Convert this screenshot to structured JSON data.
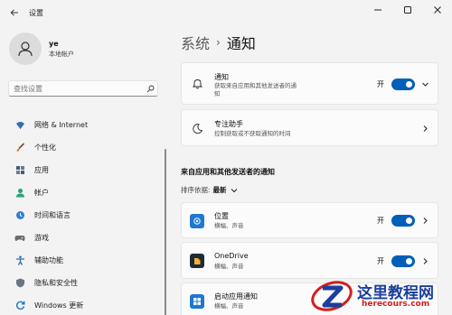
{
  "window": {
    "title": "设置"
  },
  "profile": {
    "name": "ye",
    "account_type": "本地帐户"
  },
  "search": {
    "placeholder": "查找设置"
  },
  "sidebar": {
    "items": [
      {
        "label": "网络 & Internet",
        "icon": "network-icon",
        "color": "#2f6cb8"
      },
      {
        "label": "个性化",
        "icon": "brush-icon",
        "color": "#d07a2c"
      },
      {
        "label": "应用",
        "icon": "apps-icon",
        "color": "#4a5a78"
      },
      {
        "label": "帐户",
        "icon": "person-icon",
        "color": "#2aa17a"
      },
      {
        "label": "时间和语言",
        "icon": "globe-clock-icon",
        "color": "#2f7fd0"
      },
      {
        "label": "游戏",
        "icon": "gamepad-icon",
        "color": "#6b6b6b"
      },
      {
        "label": "辅助功能",
        "icon": "accessibility-icon",
        "color": "#2f6cb8"
      },
      {
        "label": "隐私和安全性",
        "icon": "shield-icon",
        "color": "#6b7384"
      },
      {
        "label": "Windows 更新",
        "icon": "update-icon",
        "color": "#1e78d2"
      }
    ]
  },
  "breadcrumb": {
    "parent": "系统",
    "separator": "›",
    "current": "通知"
  },
  "notifications_card": {
    "title": "通知",
    "subtitle": "获取来自应用和其他发送者的通",
    "subtitle2": "知",
    "toggle_label": "开",
    "toggle_on": true
  },
  "focus_card": {
    "title": "专注助手",
    "subtitle": "控制获取或不获取通知的时间"
  },
  "senders_section": {
    "title": "来自应用和其他发送者的通知"
  },
  "sort": {
    "label": "排序依据:",
    "value": "最新"
  },
  "apps": [
    {
      "name": "位置",
      "detail": "横幅、声音",
      "toggle_label": "开",
      "toggle_on": true,
      "icon": "location-icon"
    },
    {
      "name": "OneDrive",
      "detail": "横幅、声音",
      "toggle_label": "开",
      "toggle_on": true,
      "icon": "onedrive-icon"
    },
    {
      "name": "启动应用通知",
      "detail": "横幅、声音",
      "icon": "startup-apps-icon"
    }
  ],
  "watermark": {
    "text": "这里教程网",
    "url": "herecours.com"
  },
  "colors": {
    "accent": "#005fb8",
    "background": "#f3f3f3",
    "card": "#fbfbfb"
  }
}
